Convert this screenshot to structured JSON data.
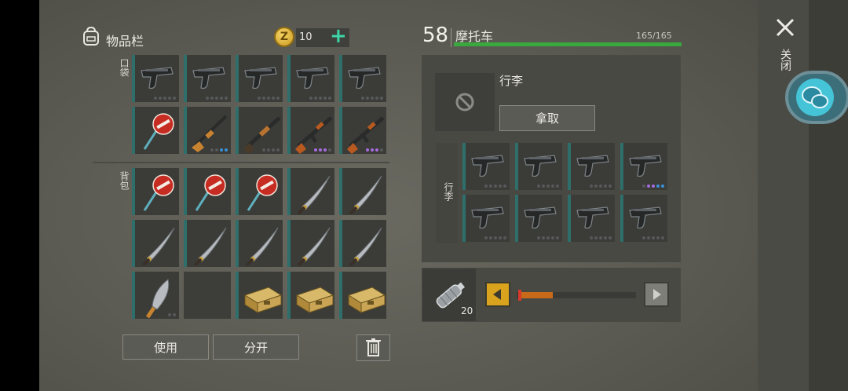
{
  "inventory": {
    "title": "物品栏",
    "coins": "10",
    "pocket_label": "口袋",
    "backpack_label": "背包",
    "pocket_slots": [
      {
        "item": "pistol-icon",
        "dots": [
          "g",
          "g",
          "g",
          "g",
          "g"
        ]
      },
      {
        "item": "pistol-icon",
        "dots": [
          "g",
          "g",
          "g",
          "g",
          "g"
        ]
      },
      {
        "item": "pistol-icon",
        "dots": [
          "g",
          "g",
          "g",
          "g",
          "g"
        ]
      },
      {
        "item": "pistol-icon",
        "dots": [
          "g",
          "g",
          "g",
          "g",
          "g"
        ]
      },
      {
        "item": "pistol-icon",
        "dots": [
          "g",
          "g",
          "g",
          "g",
          "g"
        ]
      },
      {
        "item": "stop-sign-icon",
        "dots": []
      },
      {
        "item": "rifle-icon",
        "dots": [
          "g",
          "g",
          "b",
          "b"
        ]
      },
      {
        "item": "shotgun-icon",
        "dots": [
          "g",
          "g",
          "g",
          "g"
        ]
      },
      {
        "item": "assault-rifle-icon",
        "dots": [
          "p",
          "p",
          "p",
          "g"
        ]
      },
      {
        "item": "assault-rifle-icon",
        "dots": [
          "p",
          "p",
          "p",
          "g"
        ]
      }
    ],
    "backpack_slots": [
      {
        "item": "stop-sign-icon",
        "dots": []
      },
      {
        "item": "stop-sign-icon",
        "dots": []
      },
      {
        "item": "stop-sign-icon",
        "dots": []
      },
      {
        "item": "katana-icon",
        "dots": []
      },
      {
        "item": "katana-icon",
        "dots": []
      },
      {
        "item": "katana-icon",
        "dots": []
      },
      {
        "item": "katana-icon",
        "dots": []
      },
      {
        "item": "katana-icon",
        "dots": []
      },
      {
        "item": "katana-icon",
        "dots": []
      },
      {
        "item": "katana-icon",
        "dots": []
      },
      {
        "item": "machete-icon",
        "dots": [
          "g",
          "g"
        ]
      },
      {
        "item": "empty",
        "dots": []
      },
      {
        "item": "ammo-box-icon",
        "dots": []
      },
      {
        "item": "ammo-box-icon",
        "dots": []
      },
      {
        "item": "ammo-box-icon",
        "dots": []
      }
    ],
    "use_label": "使用",
    "split_label": "分开"
  },
  "vehicle": {
    "level": "58",
    "name": "摩托车",
    "hp": "165/165",
    "hp_fraction": 1.0,
    "trunk_label": "行李",
    "take_label": "拿取",
    "cargo_label": "行李",
    "cargo_slots": [
      {
        "item": "pistol-icon",
        "dots": [
          "g",
          "g",
          "g",
          "g",
          "g"
        ]
      },
      {
        "item": "pistol-icon",
        "dots": [
          "g",
          "g",
          "g",
          "g",
          "g"
        ]
      },
      {
        "item": "pistol-icon",
        "dots": [
          "g",
          "g",
          "g",
          "g",
          "g"
        ]
      },
      {
        "item": "pistol-icon",
        "dots": [
          "g",
          "p",
          "p",
          "b",
          "b"
        ]
      },
      {
        "item": "pistol-icon",
        "dots": [
          "g",
          "g",
          "g",
          "g",
          "g"
        ]
      },
      {
        "item": "pistol-icon",
        "dots": [
          "g",
          "g",
          "g",
          "g",
          "g"
        ]
      },
      {
        "item": "pistol-icon",
        "dots": [
          "g",
          "g",
          "g",
          "g",
          "g"
        ]
      },
      {
        "item": "pistol-icon",
        "dots": [
          "g",
          "g",
          "g",
          "g",
          "g"
        ]
      }
    ],
    "fuel_count": "20",
    "fuel_fraction": 0.3
  },
  "window": {
    "close_label": "关闭"
  },
  "colors": {
    "accent_teal": "#2e6f6b",
    "hp_green": "#39a83f",
    "fuel_orange": "#c96a1a",
    "coin_gold": "#d9a31d"
  }
}
